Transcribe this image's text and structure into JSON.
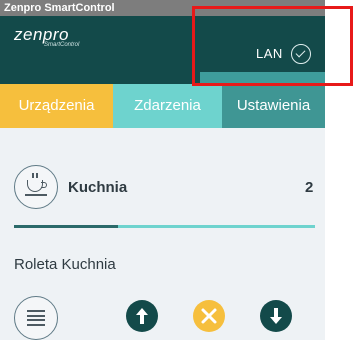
{
  "app": {
    "title": "Zenpro SmartControl"
  },
  "header": {
    "logo_main": "zenpro",
    "logo_sub": "SmartControl",
    "connection_label": "LAN",
    "connection_icon": "check-circle-icon"
  },
  "tabs": [
    {
      "label": "Urządzenia",
      "color": "#f6bf3d"
    },
    {
      "label": "Zdarzenia",
      "color": "#6ed3ce"
    },
    {
      "label": "Ustawienia",
      "color": "#3f9694",
      "selected": true
    }
  ],
  "room": {
    "name": "Kuchnia",
    "count": "2",
    "icon": "coffee-cup-icon"
  },
  "device": {
    "name": "Roleta Kuchnia",
    "controls": [
      "menu-icon",
      "arrow-up-icon",
      "stop-icon",
      "arrow-down-icon"
    ]
  },
  "colors": {
    "header_bg": "#134a4a",
    "accent_yellow": "#f6bf3d",
    "accent_teal_light": "#6ed3ce",
    "accent_teal": "#3f9694",
    "highlight_red": "#e81919"
  }
}
